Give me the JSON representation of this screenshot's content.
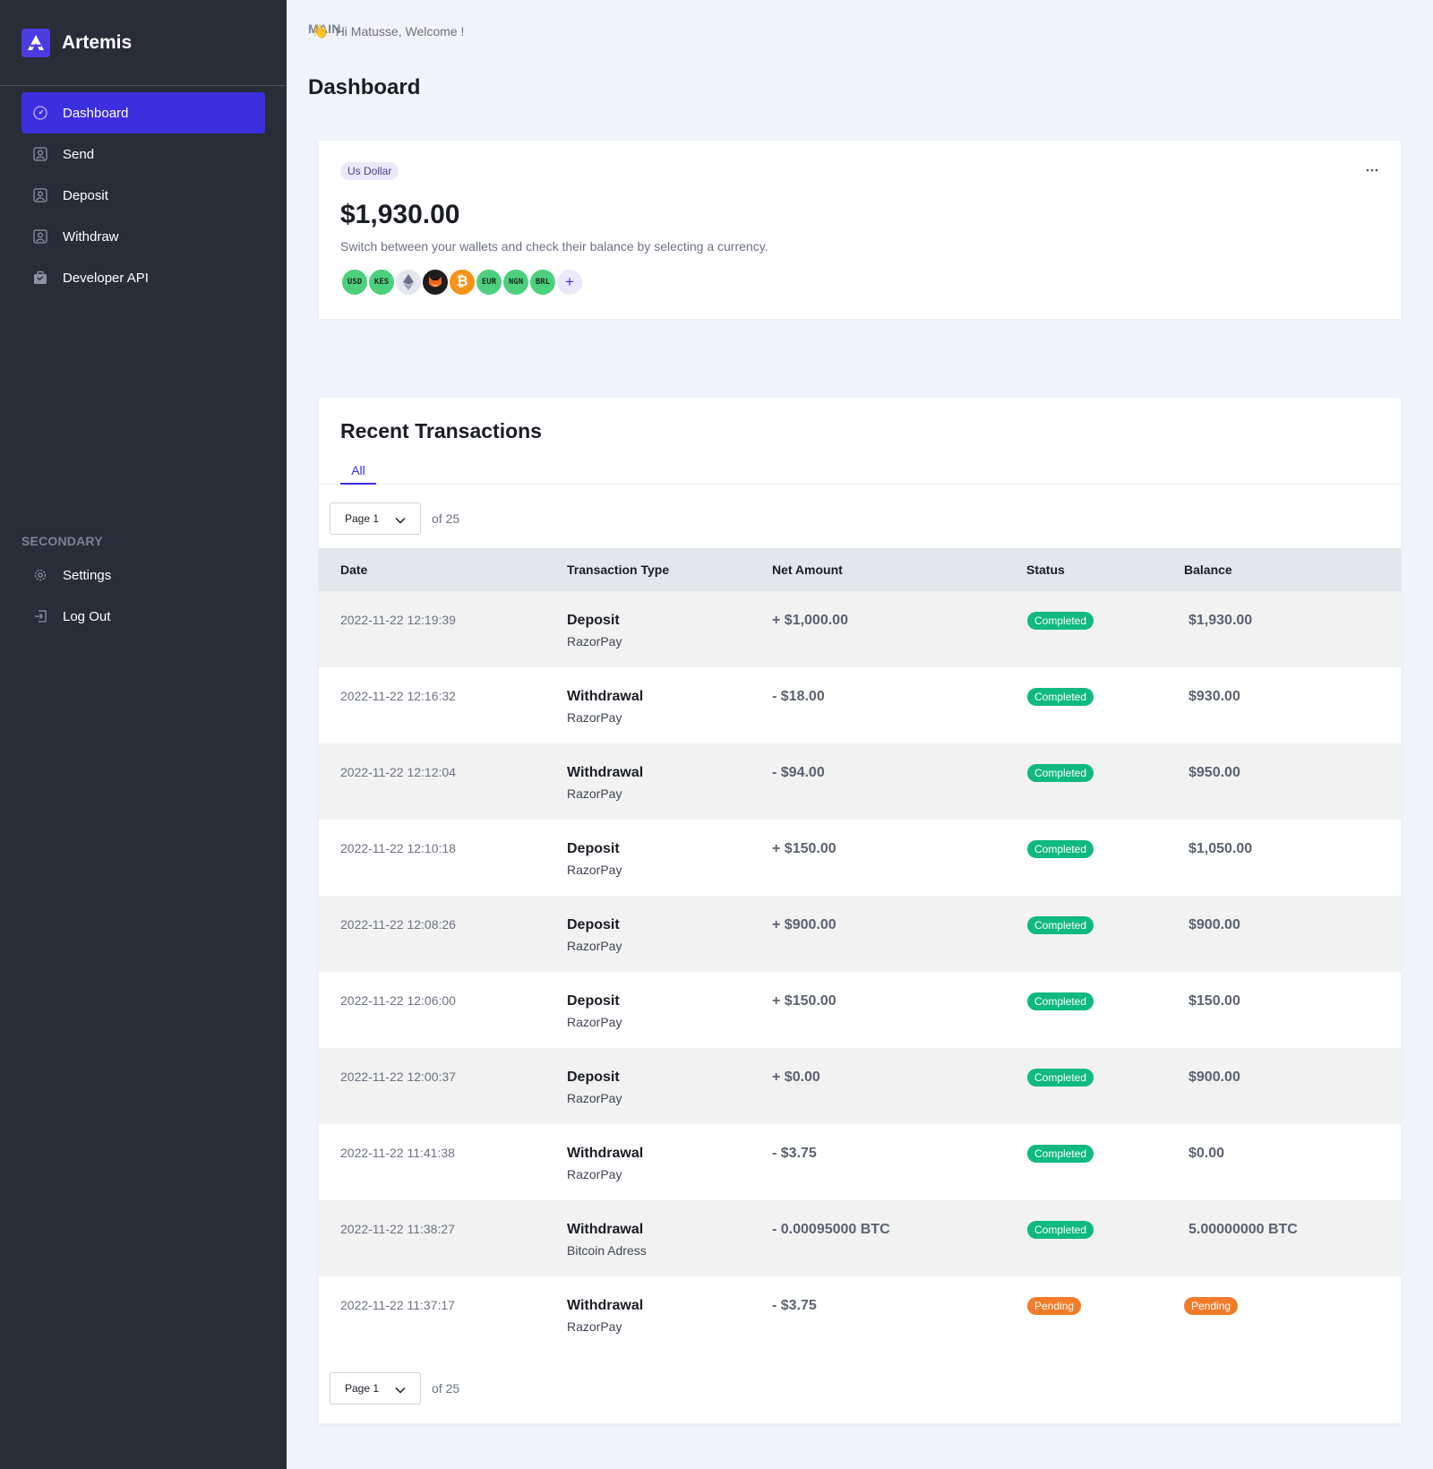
{
  "brand": {
    "name": "Artemis"
  },
  "sidebar": {
    "main_label": "MAIN",
    "main_items": [
      {
        "label": "Dashboard",
        "icon": "dashboard-icon"
      },
      {
        "label": "Send",
        "icon": "user-icon"
      },
      {
        "label": "Deposit",
        "icon": "user-icon"
      },
      {
        "label": "Withdraw",
        "icon": "user-icon"
      },
      {
        "label": "Developer API",
        "icon": "briefcase-icon"
      }
    ],
    "secondary_label": "SECONDARY",
    "secondary_items": [
      {
        "label": "Settings",
        "icon": "gear-icon"
      },
      {
        "label": "Log Out",
        "icon": "logout-icon"
      }
    ]
  },
  "header": {
    "greeting": "Hi Matusse, Welcome !",
    "title": "Dashboard"
  },
  "balance": {
    "currency": "Us Dollar",
    "amount": "$1,930.00",
    "subtitle": "Switch between your wallets and check their balance by selecting a currency.",
    "coins": [
      {
        "label": "USD",
        "color": "#4cd07d"
      },
      {
        "label": "KES",
        "color": "#4cd07d"
      },
      {
        "label": "",
        "color": "#e5e7ee",
        "icon": "ethereum-icon"
      },
      {
        "label": "",
        "color": "#1d1d1d",
        "icon": "shiba-icon"
      },
      {
        "label": "",
        "color": "#f7931a",
        "icon": "bitcoin-icon"
      },
      {
        "label": "EUR",
        "color": "#4cd07d"
      },
      {
        "label": "NGN",
        "color": "#4cd07d"
      },
      {
        "label": "BRL",
        "color": "#4cd07d"
      },
      {
        "label": "+",
        "color": "#ece8fb",
        "icon": "plus-icon"
      }
    ]
  },
  "transactions": {
    "title": "Recent Transactions",
    "tab": "All",
    "page_select": "Page 1",
    "page_of": "of 25",
    "columns": [
      "Date",
      "Transaction Type",
      "Net Amount",
      "Status",
      "Balance"
    ],
    "rows": [
      {
        "date": "2022-11-22 12:19:39",
        "type": "Deposit",
        "via": "RazorPay",
        "net": "+ $1,000.00",
        "status": "Completed",
        "balance": "$1,930.00"
      },
      {
        "date": "2022-11-22 12:16:32",
        "type": "Withdrawal",
        "via": "RazorPay",
        "net": "- $18.00",
        "status": "Completed",
        "balance": "$930.00"
      },
      {
        "date": "2022-11-22 12:12:04",
        "type": "Withdrawal",
        "via": "RazorPay",
        "net": "- $94.00",
        "status": "Completed",
        "balance": "$950.00"
      },
      {
        "date": "2022-11-22 12:10:18",
        "type": "Deposit",
        "via": "RazorPay",
        "net": "+ $150.00",
        "status": "Completed",
        "balance": "$1,050.00"
      },
      {
        "date": "2022-11-22 12:08:26",
        "type": "Deposit",
        "via": "RazorPay",
        "net": "+ $900.00",
        "status": "Completed",
        "balance": "$900.00"
      },
      {
        "date": "2022-11-22 12:06:00",
        "type": "Deposit",
        "via": "RazorPay",
        "net": "+ $150.00",
        "status": "Completed",
        "balance": "$150.00"
      },
      {
        "date": "2022-11-22 12:00:37",
        "type": "Deposit",
        "via": "RazorPay",
        "net": "+ $0.00",
        "status": "Completed",
        "balance": "$900.00"
      },
      {
        "date": "2022-11-22 11:41:38",
        "type": "Withdrawal",
        "via": "RazorPay",
        "net": "- $3.75",
        "status": "Completed",
        "balance": "$0.00"
      },
      {
        "date": "2022-11-22 11:38:27",
        "type": "Withdrawal",
        "via": "Bitcoin Adress",
        "net": "- 0.00095000 BTC",
        "status": "Completed",
        "balance": "5.00000000 BTC"
      },
      {
        "date": "2022-11-22 11:37:17",
        "type": "Withdrawal",
        "via": "RazorPay",
        "net": "- $3.75",
        "status": "Pending",
        "balance": "Pending"
      }
    ]
  },
  "colors": {
    "accent": "#3b2fe0",
    "sidebar": "#282d38",
    "completed": "#10b981",
    "pending": "#f07c2a"
  }
}
